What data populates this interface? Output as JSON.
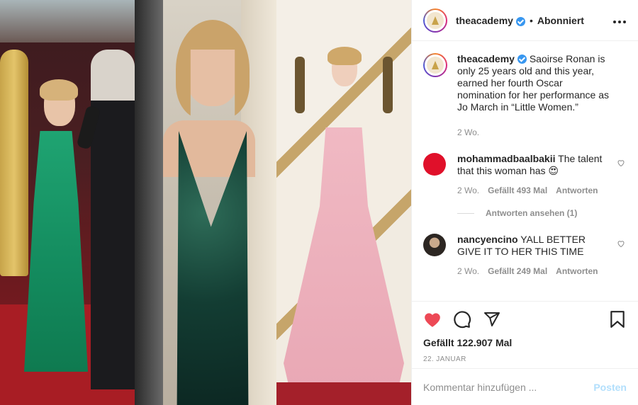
{
  "post": {
    "username": "theacademy",
    "follow_state": "Abonniert",
    "separator": "•",
    "more": "•••"
  },
  "caption": {
    "username": "theacademy",
    "text": "Saoirse Ronan is only 25 years old and this year, earned her fourth Oscar nomination for her performance as Jo March in “Little Women.”",
    "time": "2 Wo."
  },
  "comments": [
    {
      "username": "mohammadbaalbakii",
      "text": "The talent that this woman has 😍",
      "time": "2 Wo.",
      "likes": "Gefällt 493 Mal",
      "reply": "Antworten",
      "view_replies": "Antworten ansehen (1)",
      "avatar_color": "#e0102a"
    },
    {
      "username": "nancyencino",
      "text": "YALL BETTER GIVE IT TO HER THIS TIME",
      "time": "2 Wo.",
      "likes": "Gefällt 249 Mal",
      "reply": "Antworten",
      "avatar_color": "#3b3530"
    }
  ],
  "actions": {
    "like_icon": "heart-filled-icon",
    "comment_icon": "comment-icon",
    "share_icon": "paper-plane-icon",
    "save_icon": "bookmark-icon",
    "like_color": "#ed4956"
  },
  "likes_count": "Gefällt 122.907 Mal",
  "date": "22. JANUAR",
  "composer": {
    "placeholder": "Kommentar hinzufügen ...",
    "post_label": "Posten"
  },
  "colors": {
    "verified": "#3897f0",
    "muted": "#8e8e8e",
    "post_button": "#b2dffc"
  }
}
